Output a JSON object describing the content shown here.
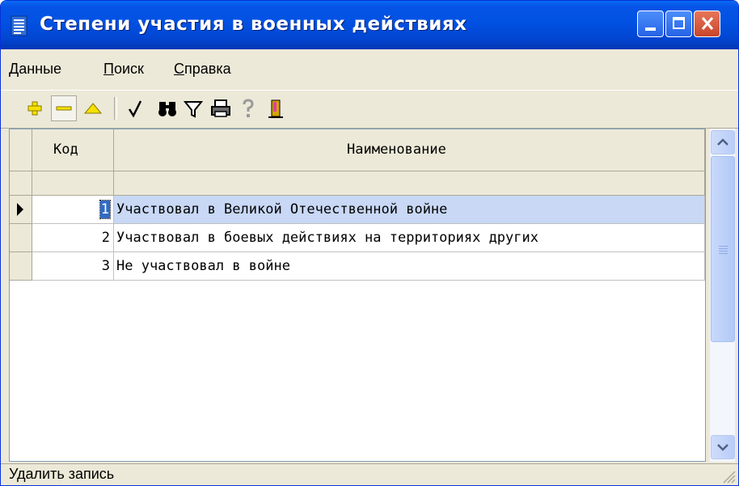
{
  "window": {
    "title": "Степени участия в военных действиях",
    "title_color": "#0152e3"
  },
  "menu": {
    "items": [
      {
        "first": "Д",
        "rest": "анные"
      },
      {
        "first": "П",
        "rest": "оиск"
      },
      {
        "first": "С",
        "rest": "правка"
      }
    ]
  },
  "toolbar": {
    "icons": [
      "add-record-icon",
      "delete-record-icon",
      "edit-record-icon",
      "confirm-check-icon",
      "find-binoculars-icon",
      "filter-funnel-icon",
      "print-icon",
      "help-question-icon",
      "exit-door-icon"
    ]
  },
  "grid": {
    "columns": {
      "code": "Код",
      "name": "Наименование"
    },
    "rows": [
      {
        "code": "1",
        "name": "Участвовал в Великой Отечественной войне",
        "selected": true
      },
      {
        "code": "2",
        "name": "Участвовал в боевых действиях на территориях других",
        "selected": false
      },
      {
        "code": "3",
        "name": "Не участвовал в войне",
        "selected": false
      }
    ]
  },
  "status": {
    "text": "Удалить запись"
  }
}
